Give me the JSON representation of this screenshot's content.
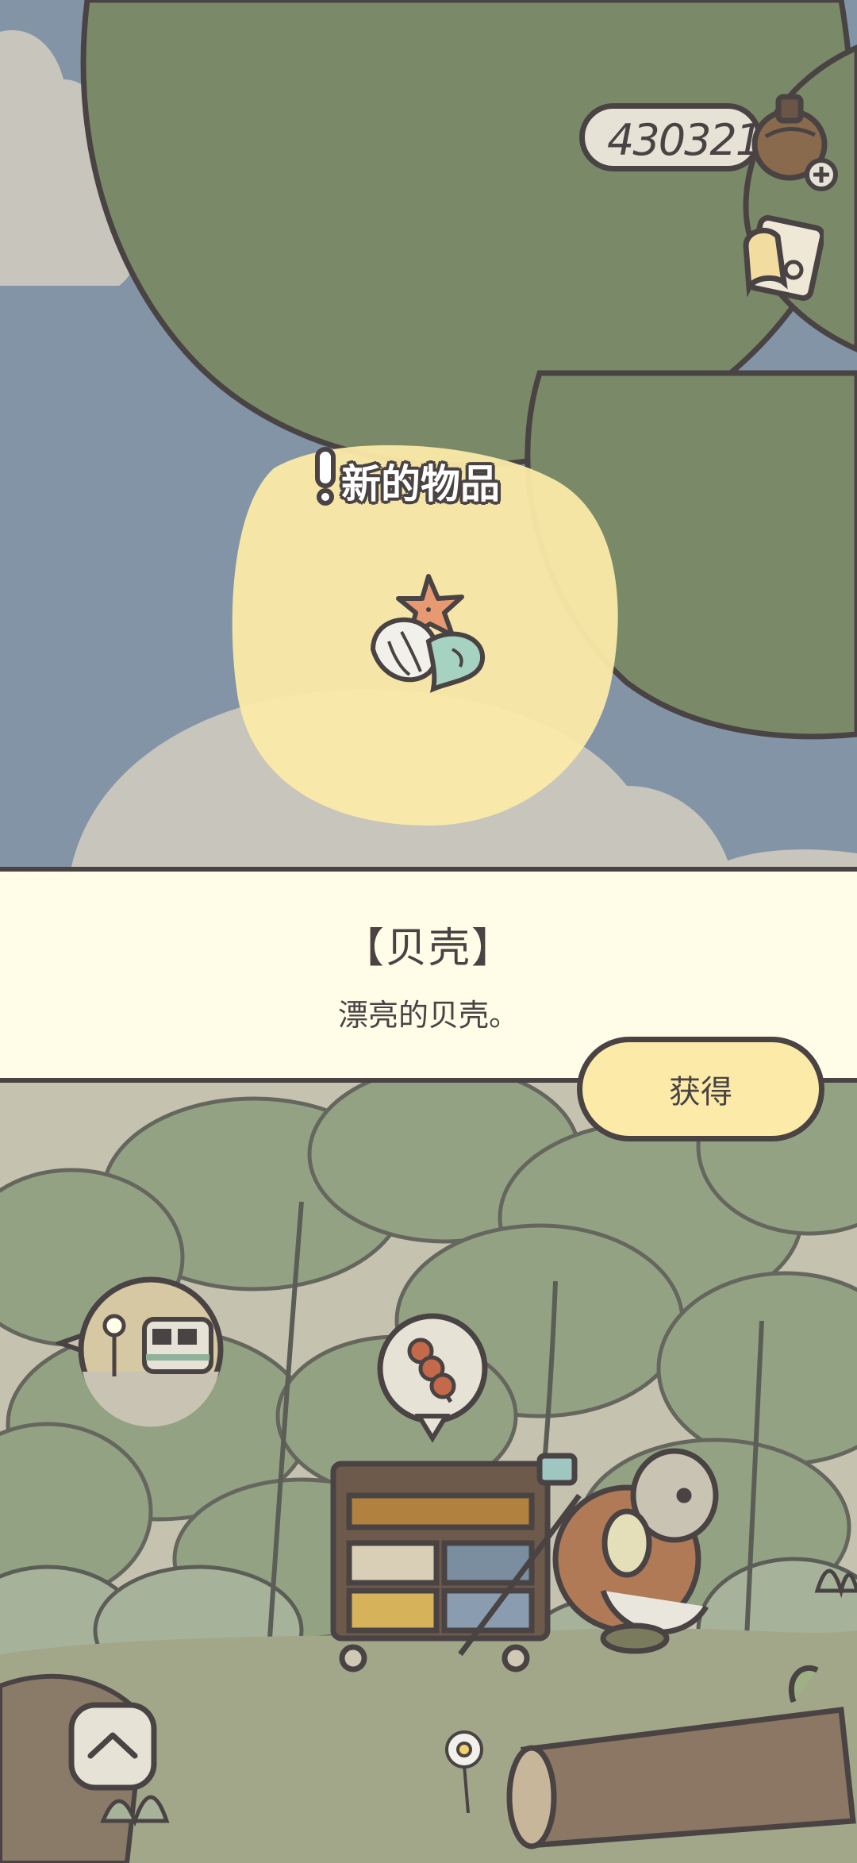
{
  "hud": {
    "coin_count": "430321"
  },
  "notification": {
    "new_item_label": "新的物品"
  },
  "item": {
    "name": "【贝壳】",
    "description": "漂亮的贝壳。"
  },
  "actions": {
    "get_label": "获得"
  },
  "icons": {
    "coin": "acorn-coin-icon",
    "add": "plus-icon",
    "album": "photo-album-icon",
    "new_item": "exclamation-icon",
    "item": "seashell-icon",
    "train": "train-station-icon",
    "food_bubble": "dango-icon",
    "expand": "chevron-up-icon"
  },
  "colors": {
    "outline": "#4a4344",
    "sky": "#8394a6",
    "leaf": "#7a8a68",
    "highlight": "#fbeaa8",
    "panel": "#fffce8"
  }
}
